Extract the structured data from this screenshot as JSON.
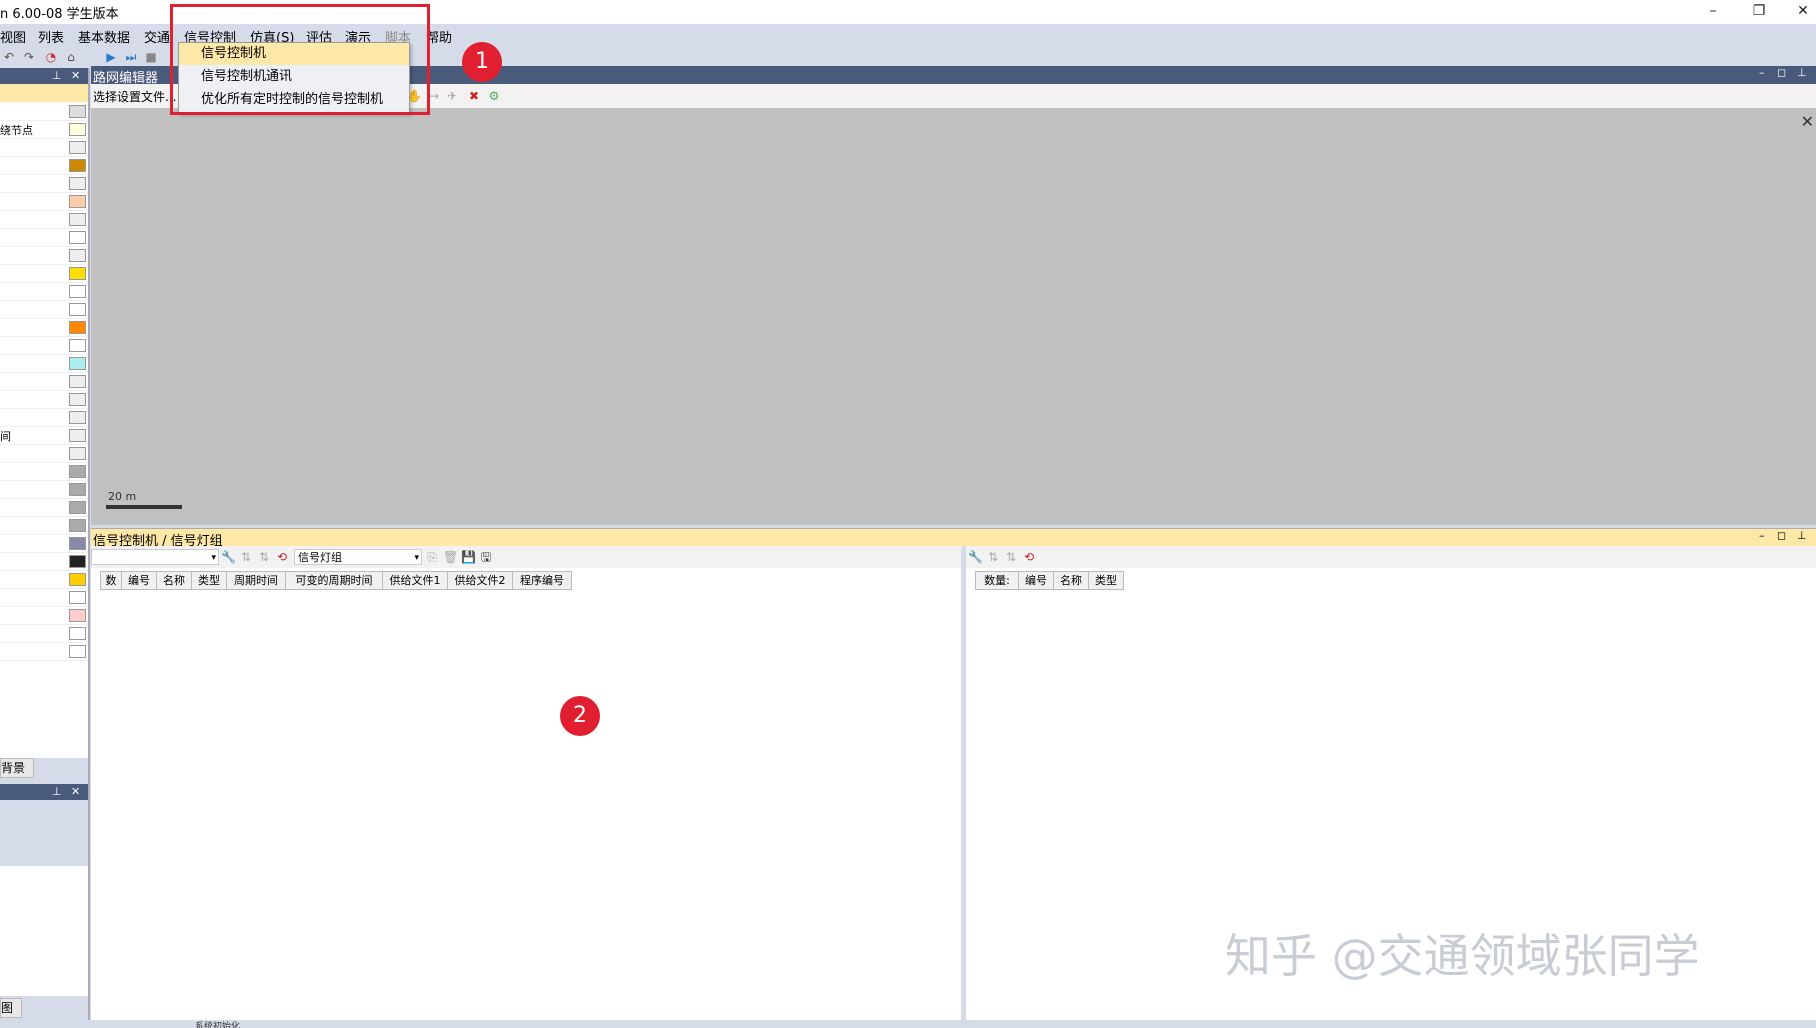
{
  "window": {
    "title": "n 6.00-08 学生版本",
    "minimize": "–",
    "restore": "❐",
    "close": "✕"
  },
  "menubar": {
    "items": [
      "视图",
      "列表",
      "基本数据",
      "交通",
      "信号控制",
      "仿真(S)",
      "评估",
      "演示",
      "脚本",
      "帮助"
    ]
  },
  "dropdown": {
    "items": [
      "信号控制机",
      "信号控制机通讯",
      "优化所有定时控制的信号控制机"
    ]
  },
  "network_editor": {
    "title": "路网编辑器",
    "toolbar_label": "选择设置文件...",
    "scale": "20 m"
  },
  "left_panel": {
    "rows": [
      "",
      "绕节点",
      "",
      "",
      "",
      "",
      "",
      "",
      "",
      "",
      "",
      "",
      "",
      "",
      "",
      "",
      "",
      "",
      "间",
      "",
      "",
      "",
      "",
      "",
      "",
      "",
      "",
      "",
      "",
      "",
      ""
    ],
    "tab_label": "背景",
    "bottom_tab_label": "图"
  },
  "signal_panel": {
    "title": "信号控制机 / 信号灯组",
    "dropdown_value": "信号灯组",
    "left_columns": [
      "数",
      "编号",
      "名称",
      "类型",
      "周期时间",
      "可变的周期时间",
      "供给文件1",
      "供给文件2",
      "程序编号"
    ],
    "right_columns": [
      "数量:",
      "编号",
      "名称",
      "类型"
    ]
  },
  "annotations": {
    "badge1": "1",
    "badge2": "2"
  },
  "watermark": "知乎 @交通领域张同学",
  "status": "系统初始化",
  "colors": {
    "highlight": "#fde8a8",
    "annotation_red": "#e02030",
    "header_blue": "#4a5a7a",
    "canvas_gray": "#c0c0c0"
  }
}
